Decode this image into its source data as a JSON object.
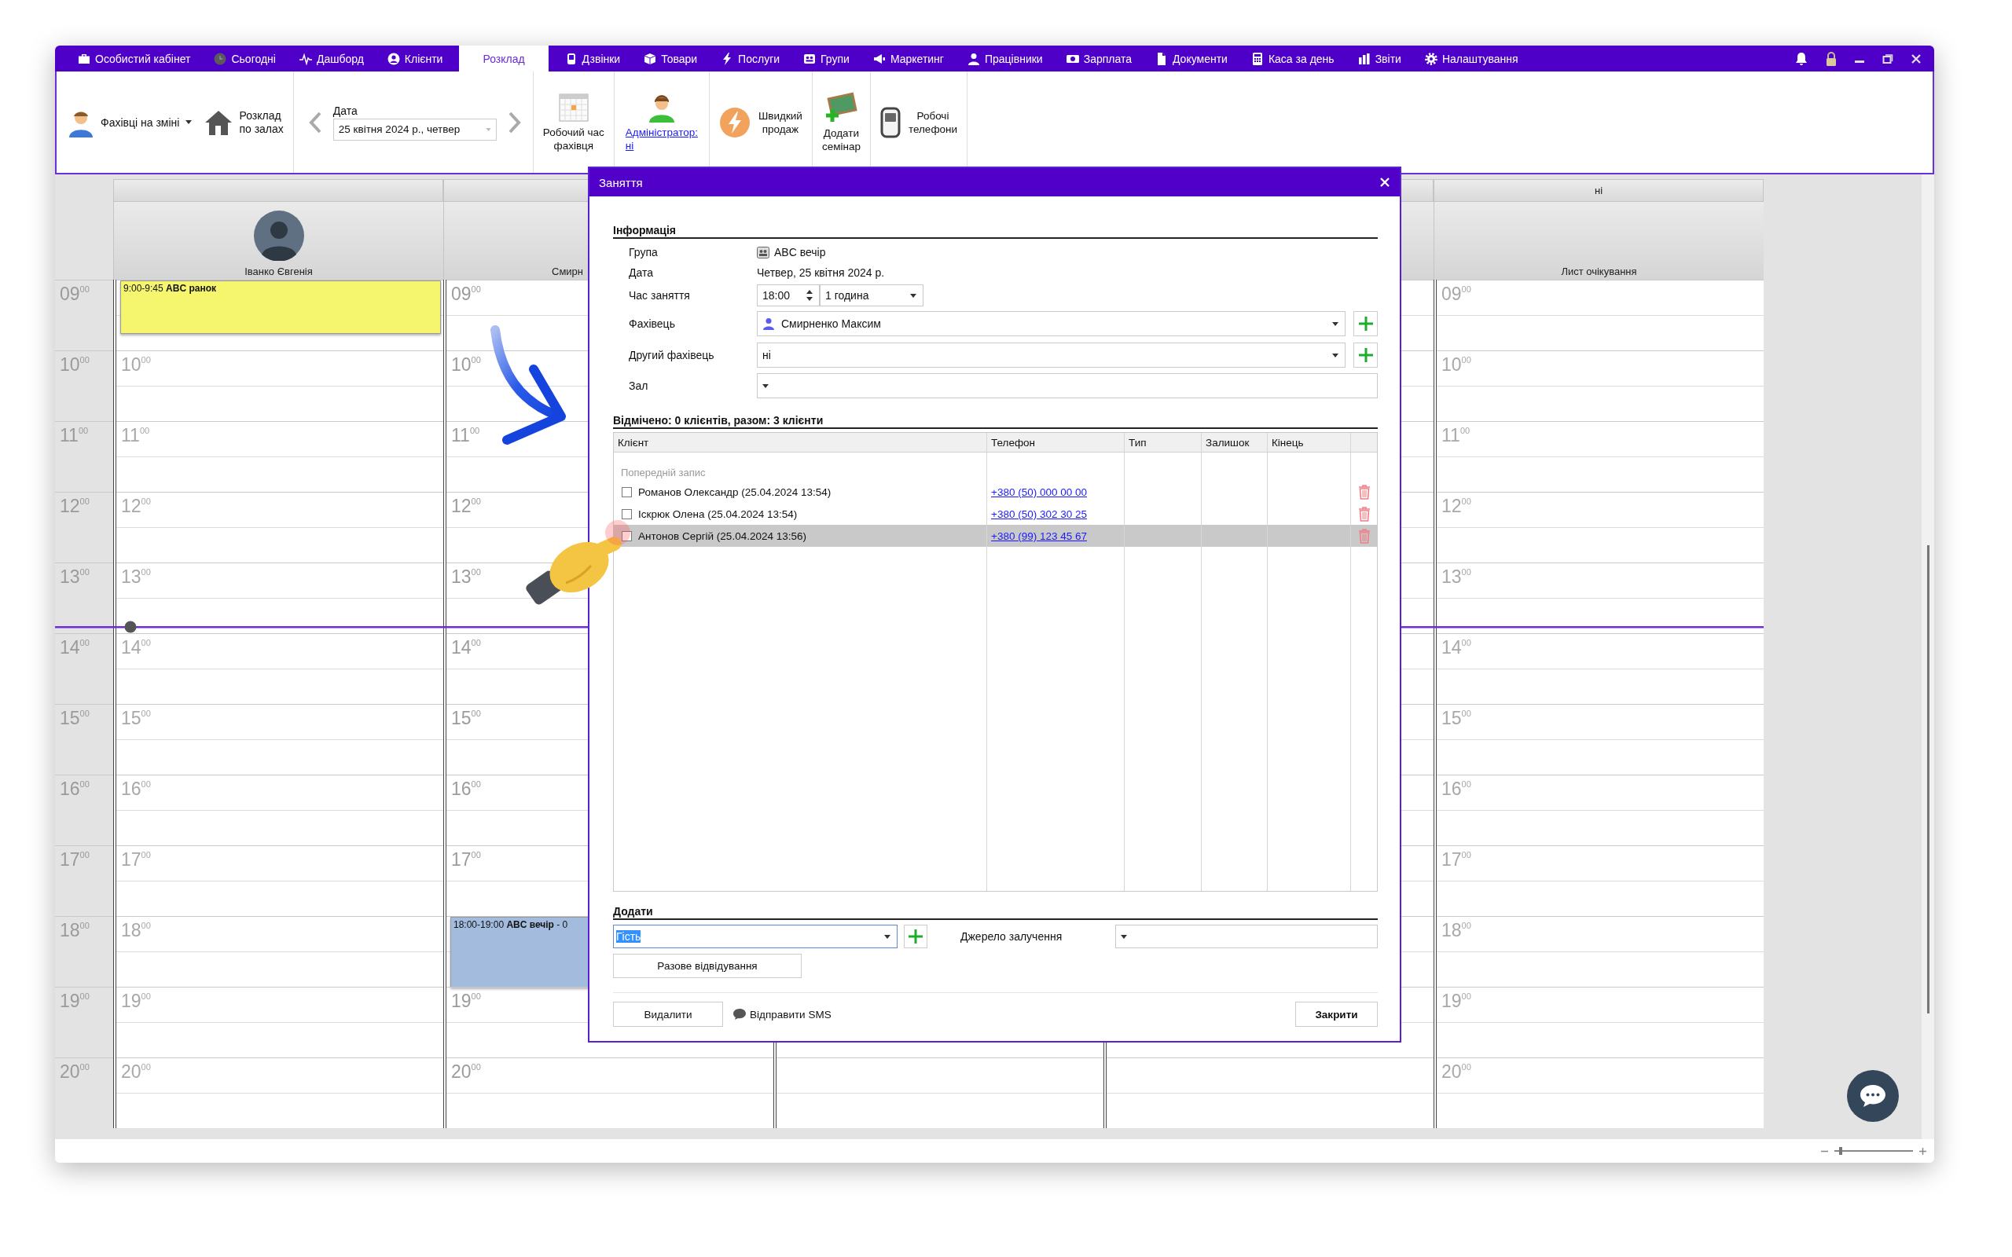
{
  "menu": {
    "tabs": [
      {
        "label": "Особистий кабінет",
        "selected": false
      },
      {
        "label": "Сьогодні",
        "selected": false
      },
      {
        "label": "Дашборд",
        "selected": false
      },
      {
        "label": "Клієнти",
        "selected": false
      },
      {
        "label": "Розклад",
        "selected": true
      },
      {
        "label": "Дзвінки",
        "selected": false
      },
      {
        "label": "Товари",
        "selected": false
      },
      {
        "label": "Послуги",
        "selected": false
      },
      {
        "label": "Групи",
        "selected": false
      },
      {
        "label": "Маркетинг",
        "selected": false
      },
      {
        "label": "Працівники",
        "selected": false
      },
      {
        "label": "Зарплата",
        "selected": false
      },
      {
        "label": "Документи",
        "selected": false
      },
      {
        "label": "Каса за день",
        "selected": false
      },
      {
        "label": "Звіти",
        "selected": false
      },
      {
        "label": "Налаштування",
        "selected": false
      }
    ]
  },
  "toolbar": {
    "staff_on_shift": "Фахівці на зміні",
    "rooms_schedule": "Розклад\nпо залах",
    "date_label": "Дата",
    "date_value": "25 квітня 2024 р., четвер",
    "tools": [
      {
        "label": "Робочий час\nфахівця",
        "kind": "button"
      },
      {
        "label": "Адміністратор:\nні",
        "kind": "link"
      },
      {
        "label": "Швидкий\nпродаж",
        "kind": "button"
      },
      {
        "label": "Додати\nсемінар",
        "kind": "button"
      },
      {
        "label": "Робочі\nтелефони",
        "kind": "button"
      }
    ]
  },
  "schedule": {
    "time_labels": [
      "09$^{00}$",
      "10$^{00}$",
      "11$^{00}$",
      "12$^{00}$",
      "13$^{00}$",
      "14$^{00}$",
      "15$^{00}$",
      "16$^{00}$",
      "17$^{00}$",
      "18$^{00}$",
      "19$^{00}$",
      "20$^{00}$"
    ],
    "columns": [
      {
        "kind": "staff",
        "name": "Іванко Євгенія",
        "rows": [
          {
            "event": {
              "text": "9:00-9:45 **ABC ранок**",
              "kind": "short",
              "color": "#f5f56e"
            }
          },
          {
            "label": "10$^{00}$"
          },
          {
            "label": "11$^{00}$"
          },
          {
            "label": "12$^{00}$"
          },
          {
            "label": "13$^{00}$"
          },
          {
            "label": "14$^{00}$"
          },
          {
            "label": "15$^{00}$"
          },
          {
            "label": "16$^{00}$"
          },
          {
            "label": "17$^{00}$"
          },
          {
            "label": "18$^{00}$"
          },
          {
            "label": "19$^{00}$"
          },
          {
            "label": "20$^{00}$"
          }
        ]
      },
      {
        "kind": "partial",
        "name": "Смирн",
        "rows": [
          {
            "label": "09$^{00}$"
          },
          {
            "label": "10$^{00}$"
          },
          {
            "label": "11$^{00}$"
          },
          {
            "label": "12$^{00}$"
          },
          {
            "label": "13$^{00}$"
          },
          {
            "label": "14$^{00}$"
          },
          {
            "label": "15$^{00}$"
          },
          {
            "label": "16$^{00}$"
          },
          {
            "label": "17$^{00}$"
          },
          {
            "event": {
              "text": "18:00-19:00 **ABC вечір** - 0",
              "kind": "hour",
              "color": "#a3bbdd"
            }
          },
          {
            "label": "19$^{00}$"
          },
          {
            "label": "20$^{00}$"
          }
        ]
      },
      {
        "kind": "covered"
      },
      {
        "kind": "blank"
      },
      {
        "kind": "waitlist",
        "band": "ні",
        "name": "Лист очікування",
        "rows": [
          {
            "label": "09$^{00}$"
          },
          {
            "label": "10$^{00}$"
          },
          {
            "label": "11$^{00}$"
          },
          {
            "label": "12$^{00}$"
          },
          {
            "label": "13$^{00}$"
          },
          {
            "label": "14$^{00}$"
          },
          {
            "label": "15$^{00}$"
          },
          {
            "label": "16$^{00}$"
          },
          {
            "label": "17$^{00}$"
          },
          {
            "label": "18$^{00}$"
          },
          {
            "label": "19$^{00}$"
          },
          {
            "label": "20$^{00}$"
          }
        ]
      }
    ]
  },
  "dialog": {
    "title": "Заняття",
    "info_heading": "Інформація",
    "fields": [
      {
        "label": "Група",
        "kind": "group",
        "value": "ABC вечір"
      },
      {
        "label": "Дата",
        "kind": "text",
        "value": "Четвер, 25 квітня 2024 р."
      },
      {
        "label": "Час заняття",
        "kind": "time",
        "value": "18:00",
        "duration": "1 година"
      },
      {
        "label": "Фахівець",
        "kind": "person_select",
        "value": "Смирненко Максим",
        "add": true
      },
      {
        "label": "Другий фахівець",
        "kind": "select",
        "value": "ні",
        "add": true
      },
      {
        "label": "Зал",
        "kind": "select",
        "add": false
      }
    ],
    "clients_heading": "Відмічено: 0 клієнтів, разом: 3 клієнти",
    "table": {
      "columns": [
        "Клієнт",
        "Телефон",
        "Тип",
        "Залишок",
        "Кінець"
      ],
      "group_label": "Попередній запис",
      "rows": [
        {
          "client": "Романов Олександр (25.04.2024 13:54)",
          "phone": "+380 (50) 000 00 00",
          "checked": false,
          "selected": false
        },
        {
          "client": "Іскрюк Олена (25.04.2024 13:54)",
          "phone": "+380 (50) 302 30 25",
          "checked": false,
          "selected": false
        },
        {
          "client": "Антонов Сергій (25.04.2024 13:56)",
          "phone": "+380 (99) 123 45 67",
          "checked": false,
          "selected": true
        }
      ]
    },
    "add_heading": "Додати",
    "guest_value": "Гість",
    "source_label": "Джерело залучення",
    "one_time_button": "Разове відвідування",
    "delete_button": "Видалити",
    "sms_button": "Відправити SMS",
    "close_button": "Закрити"
  },
  "status_bar": {
    "zoom": {
      "level": 0.08
    }
  }
}
